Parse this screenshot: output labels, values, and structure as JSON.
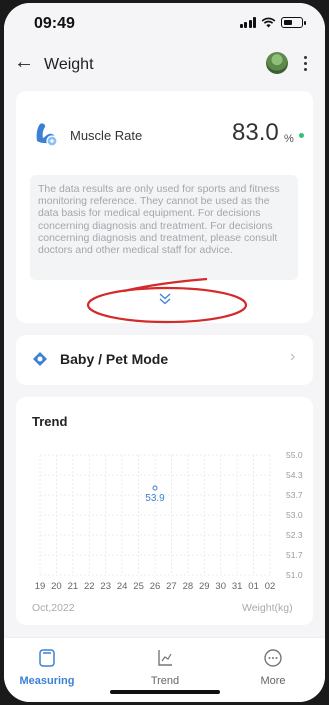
{
  "status_bar": {
    "time": "09:49"
  },
  "nav": {
    "title": "Weight",
    "back_icon": "back-arrow-icon",
    "more_icon": "more-vertical-icon"
  },
  "muscle": {
    "label": "Muscle Rate",
    "value": "83.0",
    "unit": "%",
    "status_color": "#2ec27e",
    "disclaimer": "The data results are only used for sports and fitness monitoring reference. They cannot be used as the data basis for medical equipment. For decisions concerning diagnosis and treatment. For decisions concerning diagnosis and treatment, please consult doctors and other medical staff for advice."
  },
  "baby_mode": {
    "label": "Baby / Pet Mode"
  },
  "trend": {
    "title": "Trend",
    "month": "Oct,2022",
    "unit": "Weight(kg)",
    "point_label": "53.9"
  },
  "chart_data": {
    "type": "scatter",
    "x_ticks": [
      "19",
      "20",
      "21",
      "22",
      "23",
      "24",
      "25",
      "26",
      "27",
      "28",
      "29",
      "30",
      "31",
      "01",
      "02"
    ],
    "y_ticks": [
      "55.0",
      "54.3",
      "53.7",
      "53.0",
      "52.3",
      "51.7",
      "51.0"
    ],
    "ylim": [
      51.0,
      55.0
    ],
    "points": [
      {
        "x": "26",
        "y": 53.9
      }
    ],
    "grid": true,
    "accent_color": "#3c80d6"
  },
  "tabs": [
    {
      "label": "Measuring",
      "icon": "scale-icon",
      "active": true
    },
    {
      "label": "Trend",
      "icon": "trend-icon",
      "active": false
    },
    {
      "label": "More",
      "icon": "more-icon",
      "active": false
    }
  ],
  "colors": {
    "accent": "#3c80d6",
    "annotation": "#d42a2a"
  }
}
